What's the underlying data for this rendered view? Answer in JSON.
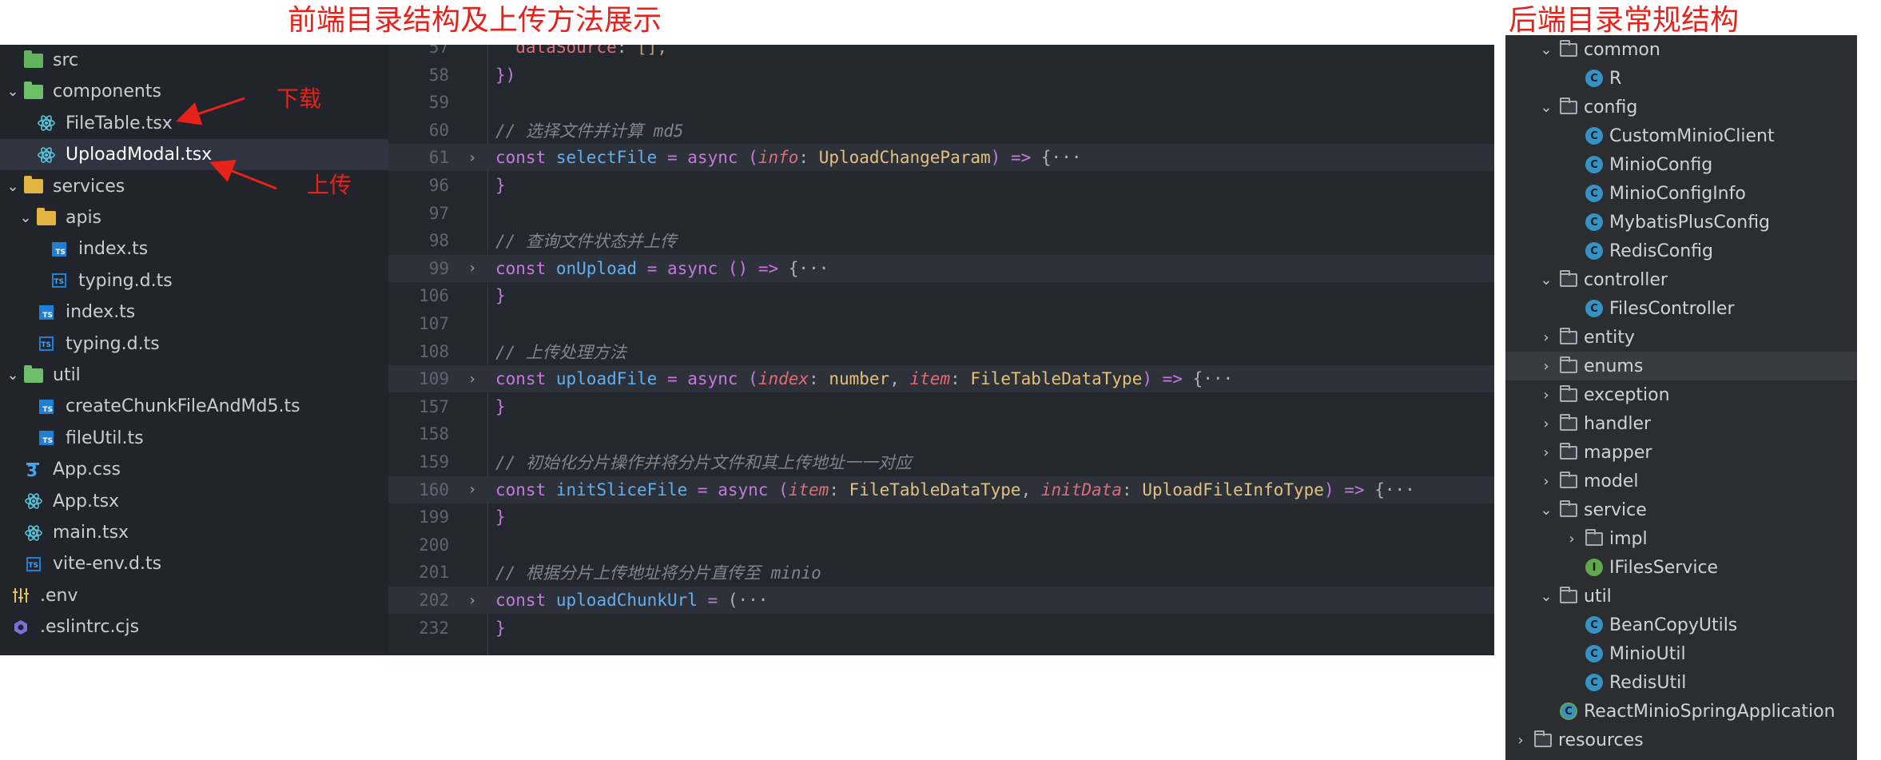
{
  "captions": {
    "left": "前端目录结构及上传方法展示",
    "right": "后端目录常规结构"
  },
  "annotations": {
    "download": "下载",
    "upload": "上传"
  },
  "explorer": {
    "items": [
      {
        "label": "src",
        "icon": "src-folder-icon",
        "twisty": ""
      },
      {
        "label": "components",
        "icon": "folder-open-icon",
        "twisty": "⌄"
      },
      {
        "label": "FileTable.tsx",
        "icon": "react-icon",
        "twisty": ""
      },
      {
        "label": "UploadModal.tsx",
        "icon": "react-icon",
        "twisty": ""
      },
      {
        "label": "services",
        "icon": "folder-open-icon",
        "twisty": "⌄"
      },
      {
        "label": "apis",
        "icon": "folder-open-icon",
        "twisty": "⌄"
      },
      {
        "label": "index.ts",
        "icon": "typescript-icon",
        "twisty": ""
      },
      {
        "label": "typing.d.ts",
        "icon": "typescript-def-icon",
        "twisty": ""
      },
      {
        "label": "index.ts",
        "icon": "typescript-icon",
        "twisty": ""
      },
      {
        "label": "typing.d.ts",
        "icon": "typescript-def-icon",
        "twisty": ""
      },
      {
        "label": "util",
        "icon": "folder-open-icon",
        "twisty": "⌄"
      },
      {
        "label": "createChunkFileAndMd5.ts",
        "icon": "typescript-icon",
        "twisty": ""
      },
      {
        "label": "fileUtil.ts",
        "icon": "typescript-icon",
        "twisty": ""
      },
      {
        "label": "App.css",
        "icon": "css-icon",
        "twisty": ""
      },
      {
        "label": "App.tsx",
        "icon": "react-icon",
        "twisty": ""
      },
      {
        "label": "main.tsx",
        "icon": "react-icon",
        "twisty": ""
      },
      {
        "label": "vite-env.d.ts",
        "icon": "typescript-def-icon",
        "twisty": ""
      },
      {
        "label": ".env",
        "icon": "settings-icon",
        "twisty": ""
      },
      {
        "label": ".eslintrc.cjs",
        "icon": "eslint-icon",
        "twisty": ""
      }
    ]
  },
  "editor": {
    "lines": [
      {
        "num": "57",
        "fold": "",
        "code": "  dataSource: [],"
      },
      {
        "num": "58",
        "fold": "",
        "code": "})"
      },
      {
        "num": "59",
        "fold": "",
        "code": ""
      },
      {
        "num": "60",
        "fold": "",
        "code": "// 选择文件并计算 md5"
      },
      {
        "num": "61",
        "fold": "›",
        "code": "const selectFile = async (info: UploadChangeParam) => {···"
      },
      {
        "num": "96",
        "fold": "",
        "code": "}"
      },
      {
        "num": "97",
        "fold": "",
        "code": ""
      },
      {
        "num": "98",
        "fold": "",
        "code": "// 查询文件状态并上传"
      },
      {
        "num": "99",
        "fold": "›",
        "code": "const onUpload = async () => {···"
      },
      {
        "num": "106",
        "fold": "",
        "code": "}"
      },
      {
        "num": "107",
        "fold": "",
        "code": ""
      },
      {
        "num": "108",
        "fold": "",
        "code": "// 上传处理方法"
      },
      {
        "num": "109",
        "fold": "›",
        "code": "const uploadFile = async (index: number, item: FileTableDataType) => {···"
      },
      {
        "num": "157",
        "fold": "",
        "code": "}"
      },
      {
        "num": "158",
        "fold": "",
        "code": ""
      },
      {
        "num": "159",
        "fold": "",
        "code": "// 初始化分片操作并将分片文件和其上传地址一一对应"
      },
      {
        "num": "160",
        "fold": "›",
        "code": "const initSliceFile = async (item: FileTableDataType, initData: UploadFileInfoType) => {···"
      },
      {
        "num": "199",
        "fold": "",
        "code": "}"
      },
      {
        "num": "200",
        "fold": "",
        "code": ""
      },
      {
        "num": "201",
        "fold": "",
        "code": "// 根据分片上传地址将分片直传至 minio"
      },
      {
        "num": "202",
        "fold": "›",
        "code": "const uploadChunkUrl = (···"
      },
      {
        "num": "232",
        "fold": "",
        "code": "}"
      }
    ]
  },
  "project_tree": {
    "items": [
      {
        "label": "common",
        "kind": "folder",
        "twisty": "⌄"
      },
      {
        "label": "R",
        "kind": "class",
        "twisty": ""
      },
      {
        "label": "config",
        "kind": "folder",
        "twisty": "⌄"
      },
      {
        "label": "CustomMinioClient",
        "kind": "class",
        "twisty": ""
      },
      {
        "label": "MinioConfig",
        "kind": "class",
        "twisty": ""
      },
      {
        "label": "MinioConfigInfo",
        "kind": "class",
        "twisty": ""
      },
      {
        "label": "MybatisPlusConfig",
        "kind": "class",
        "twisty": ""
      },
      {
        "label": "RedisConfig",
        "kind": "class",
        "twisty": ""
      },
      {
        "label": "controller",
        "kind": "folder",
        "twisty": "⌄"
      },
      {
        "label": "FilesController",
        "kind": "class",
        "twisty": ""
      },
      {
        "label": "entity",
        "kind": "folder",
        "twisty": "›"
      },
      {
        "label": "enums",
        "kind": "folder",
        "twisty": "›"
      },
      {
        "label": "exception",
        "kind": "folder",
        "twisty": "›"
      },
      {
        "label": "handler",
        "kind": "folder",
        "twisty": "›"
      },
      {
        "label": "mapper",
        "kind": "folder",
        "twisty": "›"
      },
      {
        "label": "model",
        "kind": "folder",
        "twisty": "›"
      },
      {
        "label": "service",
        "kind": "folder",
        "twisty": "⌄"
      },
      {
        "label": "impl",
        "kind": "folder",
        "twisty": "›"
      },
      {
        "label": "IFilesService",
        "kind": "interface",
        "twisty": ""
      },
      {
        "label": "util",
        "kind": "folder",
        "twisty": "⌄"
      },
      {
        "label": "BeanCopyUtils",
        "kind": "class",
        "twisty": ""
      },
      {
        "label": "MinioUtil",
        "kind": "class",
        "twisty": ""
      },
      {
        "label": "RedisUtil",
        "kind": "class",
        "twisty": ""
      },
      {
        "label": "ReactMinioSpringApplication",
        "kind": "app",
        "twisty": ""
      },
      {
        "label": "resources",
        "kind": "folder",
        "twisty": "›"
      }
    ]
  },
  "colors": {
    "annotation": "#e8221b",
    "editor_bg": "#23272e",
    "explorer_bg": "#21252b",
    "intellij_bg": "#2b2d30"
  }
}
